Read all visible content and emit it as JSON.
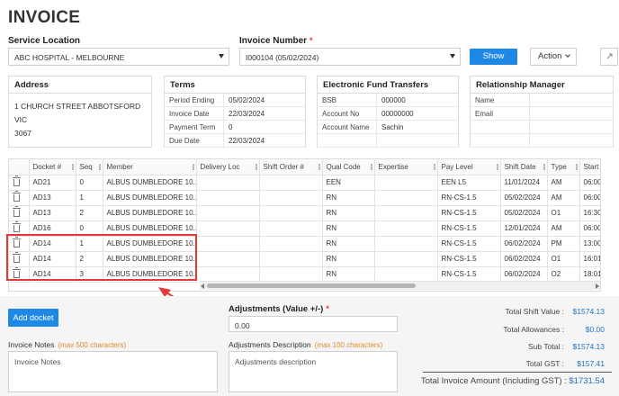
{
  "page": {
    "title": "INVOICE"
  },
  "service_location": {
    "label": "Service Location",
    "value": "ABC HOSPITAL - MELBOURNE"
  },
  "invoice_number": {
    "label": "Invoice Number",
    "required_mark": "*",
    "value": "I000104 (05/02/2024)"
  },
  "toolbar": {
    "show_label": "Show",
    "action_label": "Action"
  },
  "address": {
    "title": "Address",
    "line1": "1 CHURCH STREET ABBOTSFORD VIC",
    "line2": "3067"
  },
  "terms": {
    "title": "Terms",
    "rows": [
      {
        "k": "Period Ending",
        "v": "05/02/2024"
      },
      {
        "k": "Invoice Date",
        "v": "22/03/2024"
      },
      {
        "k": "Payment Term",
        "v": "0"
      },
      {
        "k": "Due Date",
        "v": "22/03/2024"
      }
    ]
  },
  "eft": {
    "title": "Electronic Fund Transfers",
    "rows": [
      {
        "k": "BSB",
        "v": "000000"
      },
      {
        "k": "Account No",
        "v": "00000000"
      },
      {
        "k": "Account Name",
        "v": "Sachin"
      },
      {
        "k": "",
        "v": ""
      }
    ]
  },
  "relationship": {
    "title": "Relationship Manager",
    "rows": [
      {
        "k": "Name",
        "v": ""
      },
      {
        "k": "Email",
        "v": ""
      },
      {
        "k": "",
        "v": ""
      },
      {
        "k": "",
        "v": ""
      }
    ]
  },
  "grid": {
    "columns": [
      "",
      "Docket #",
      "Seq",
      "Member",
      "Delivery Loc",
      "Shift Order #",
      "Qual Code",
      "Expertise",
      "Pay Level",
      "Shift Date",
      "Type",
      "Start"
    ],
    "rows": [
      [
        "AD21",
        "0",
        "ALBUS DUMBLEDORE 10...",
        "",
        "",
        "EEN",
        "",
        "EEN L5",
        "11/01/2024",
        "AM",
        "06:00"
      ],
      [
        "AD13",
        "1",
        "ALBUS DUMBLEDORE 10...",
        "",
        "",
        "RN",
        "",
        "RN-CS-1.5",
        "05/02/2024",
        "AM",
        "06:00"
      ],
      [
        "AD13",
        "2",
        "ALBUS DUMBLEDORE 10...",
        "",
        "",
        "RN",
        "",
        "RN-CS-1.5",
        "05/02/2024",
        "O1",
        "16:30"
      ],
      [
        "AD16",
        "0",
        "ALBUS DUMBLEDORE 10...",
        "",
        "",
        "RN",
        "",
        "RN-CS-1.5",
        "12/01/2024",
        "AM",
        "06:00"
      ],
      [
        "AD14",
        "1",
        "ALBUS DUMBLEDORE 10...",
        "",
        "",
        "RN",
        "",
        "RN-CS-1.5",
        "06/02/2024",
        "PM",
        "13:00"
      ],
      [
        "AD14",
        "2",
        "ALBUS DUMBLEDORE 10...",
        "",
        "",
        "RN",
        "",
        "RN-CS-1.5",
        "06/02/2024",
        "O1",
        "16:01"
      ],
      [
        "AD14",
        "3",
        "ALBUS DUMBLEDORE 10...",
        "",
        "",
        "RN",
        "",
        "RN-CS-1.5",
        "06/02/2024",
        "O2",
        "18:01"
      ]
    ]
  },
  "add_docket": {
    "label": "Add docket"
  },
  "adjustments": {
    "label": "Adjustments (Value +/-)",
    "required_mark": "*",
    "value": "0.00"
  },
  "invoice_notes": {
    "label": "Invoice Notes",
    "hint": "(max 500 characters)",
    "placeholder": "Invoice Notes"
  },
  "adjust_desc": {
    "label": "Adjustments Description",
    "hint": "(max 100 characters)",
    "placeholder": "Adjustments description"
  },
  "totals": [
    {
      "k": "Total Shift Value :",
      "v": "$1574.13"
    },
    {
      "k": "Total Allowances :",
      "v": "$0.00"
    },
    {
      "k": "Sub Total :",
      "v": "$1574.13"
    },
    {
      "k": "Total GST :",
      "v": "$157.41"
    }
  ],
  "grand_total": {
    "k": "Total Invoice Amount (Including GST) :",
    "v": "$1731.54"
  },
  "colors": {
    "accent": "#1e88e5",
    "highlight": "#e53935",
    "hint": "#e08a2a",
    "required": "#e0413a"
  }
}
